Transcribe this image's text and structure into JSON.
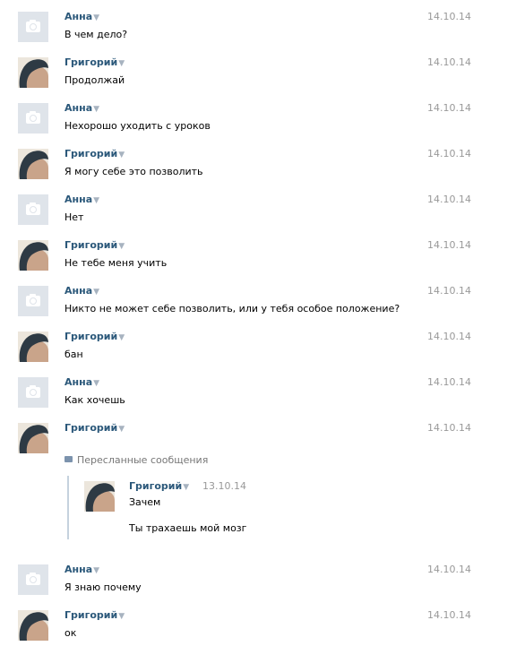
{
  "messages": [
    {
      "author": "Анна",
      "date": "14.10.14",
      "text": "В чем дело?",
      "avatar": "camera-placeholder"
    },
    {
      "author": "Григорий",
      "date": "14.10.14",
      "text": "Продолжай",
      "avatar": "photo"
    },
    {
      "author": "Анна",
      "date": "14.10.14",
      "text": "Нехорошо уходить с уроков",
      "avatar": "camera-placeholder"
    },
    {
      "author": "Григорий",
      "date": "14.10.14",
      "text": "Я могу себе это позволить",
      "avatar": "photo"
    },
    {
      "author": "Анна",
      "date": "14.10.14",
      "text": "Нет",
      "avatar": "camera-placeholder"
    },
    {
      "author": "Григорий",
      "date": "14.10.14",
      "text": "Не тебе меня учить",
      "avatar": "photo"
    },
    {
      "author": "Анна",
      "date": "14.10.14",
      "text": "Никто не может себе позволить, или у тебя особое положение?",
      "avatar": "camera-placeholder"
    },
    {
      "author": "Григорий",
      "date": "14.10.14",
      "text": "бан",
      "avatar": "photo"
    },
    {
      "author": "Анна",
      "date": "14.10.14",
      "text": "Как хочешь",
      "avatar": "camera-placeholder"
    },
    {
      "author": "Григорий",
      "date": "14.10.14",
      "text": "",
      "avatar": "photo"
    },
    {
      "author": "Анна",
      "date": "14.10.14",
      "text": "Я знаю почему",
      "avatar": "camera-placeholder"
    },
    {
      "author": "Григорий",
      "date": "14.10.14",
      "text": "ок",
      "avatar": "photo"
    }
  ],
  "forwarded": {
    "header": "Пересланные сообщения",
    "author": "Григорий",
    "date": "13.10.14",
    "text1": "Зачем",
    "text2": "Ты трахаешь мой мозг"
  },
  "colors": {
    "author": "#2b587a",
    "date": "#999999",
    "placeholder_bg": "#dfe4ea"
  },
  "icons": {
    "author_menu": "▼"
  }
}
